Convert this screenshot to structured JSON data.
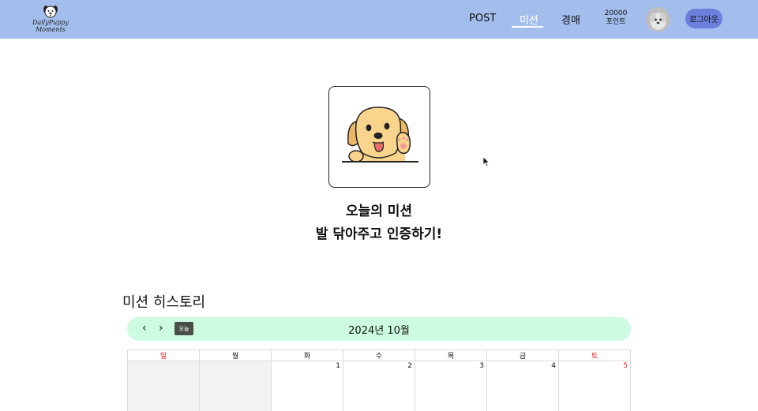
{
  "header": {
    "logo_line1": "DailyPuppy",
    "logo_line2": "Moments",
    "nav": {
      "post": "POST",
      "mission": "미션",
      "auction": "경매"
    },
    "points_value": "20000",
    "points_label": "포인트",
    "logout_label": "로그아웃"
  },
  "mission": {
    "title": "오늘의 미션",
    "description": "발 닦아주고 인증하기!"
  },
  "history": {
    "title": "미션 히스토리"
  },
  "calendar": {
    "prev_icon": "‹",
    "next_icon": "›",
    "today_label": "오늘",
    "month_label": "2024년 10월",
    "weekdays": [
      "일",
      "월",
      "화",
      "수",
      "목",
      "금",
      "토"
    ],
    "first_week": [
      "",
      "",
      "1",
      "2",
      "3",
      "4",
      "5"
    ]
  },
  "colors": {
    "header_bg": "#a3bdec",
    "logout_bg": "#6b7fdc",
    "calendar_bar_bg": "#ccfbe2",
    "weekend_red": "#e02020"
  }
}
